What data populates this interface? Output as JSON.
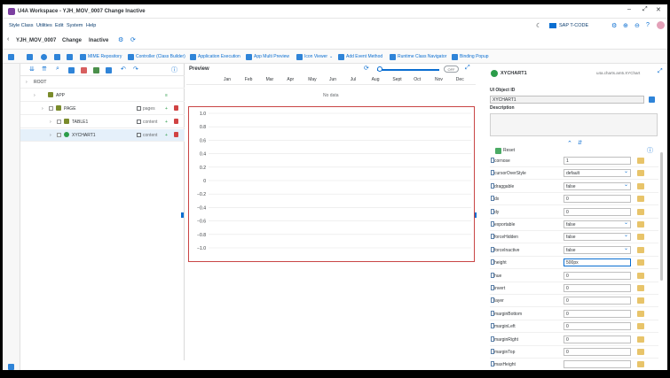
{
  "window": {
    "title": "U4A Workspace - YJH_MOV_0007 Change Inactive"
  },
  "menu": [
    "Style Class",
    "Utilities",
    "Edit",
    "System",
    "Help"
  ],
  "sys_label": "SAP T-CODE",
  "appbar": {
    "app_id": "YJH_MOV_0007",
    "mode": "Change",
    "status": "Inactive"
  },
  "toolbar": {
    "buttons": [
      "MIME Repository",
      "Controller (Class Builder)",
      "Application Execution",
      "App Multi Preview",
      "Icon Viewer",
      "Add Event Method",
      "Runtime Class Navigator",
      "Binding Popup"
    ]
  },
  "tree": {
    "rows": [
      {
        "name": "ROOT",
        "type": "",
        "indent": 0
      },
      {
        "name": "APP",
        "type": "",
        "indent": 1
      },
      {
        "name": "PAGE",
        "type": "pages",
        "indent": 2
      },
      {
        "name": "TABLE1",
        "type": "content",
        "indent": 3
      },
      {
        "name": "XYCHART1",
        "type": "content",
        "indent": 3
      }
    ]
  },
  "preview": {
    "title": "Preview",
    "toggle": "OFF",
    "months": [
      "Jan",
      "Feb",
      "Mar",
      "Apr",
      "May",
      "Jun",
      "Jul",
      "Aug",
      "Sept",
      "Oct",
      "Nov",
      "Dec"
    ],
    "no_data": "No data"
  },
  "chart_data": {
    "type": "line",
    "title": "",
    "yticks": [
      "1.0",
      "0.8",
      "0.6",
      "0.4",
      "0.2",
      "0",
      "−0.2",
      "−0.4",
      "−0.6",
      "−0.8",
      "−1.0"
    ],
    "ylim": [
      -1.0,
      1.0
    ],
    "series": []
  },
  "props": {
    "header": "XYCHART1",
    "class_name": "u4a.charts.am5.XYChart",
    "ui_object_id_label": "UI Object ID",
    "ui_object_id": "XYCHART1",
    "description_label": "Description",
    "reset_label": "Reset",
    "rows": [
      {
        "name": "cornose",
        "value": "1",
        "sel": false
      },
      {
        "name": "cursorOverStyle",
        "value": "default",
        "sel": true
      },
      {
        "name": "draggable",
        "value": "false",
        "sel": true
      },
      {
        "name": "dx",
        "value": "0",
        "sel": false
      },
      {
        "name": "dy",
        "value": "0",
        "sel": false
      },
      {
        "name": "exportable",
        "value": "false",
        "sel": true
      },
      {
        "name": "forceHidden",
        "value": "false",
        "sel": true
      },
      {
        "name": "forceInactive",
        "value": "false",
        "sel": true
      },
      {
        "name": "height",
        "value": "500px",
        "sel": false
      },
      {
        "name": "hue",
        "value": "0",
        "sel": false
      },
      {
        "name": "invert",
        "value": "0",
        "sel": false
      },
      {
        "name": "layer",
        "value": "0",
        "sel": false
      },
      {
        "name": "marginBottom",
        "value": "0",
        "sel": false
      },
      {
        "name": "marginLeft",
        "value": "0",
        "sel": false
      },
      {
        "name": "marginRight",
        "value": "0",
        "sel": false
      },
      {
        "name": "marginTop",
        "value": "0",
        "sel": false
      },
      {
        "name": "maxHeight",
        "value": "",
        "sel": false
      }
    ]
  }
}
